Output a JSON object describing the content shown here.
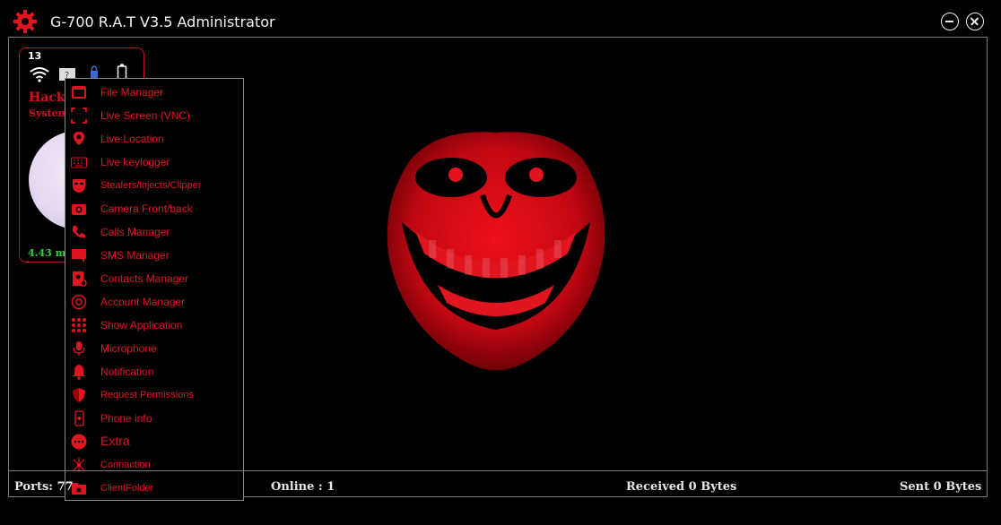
{
  "window": {
    "title": "G-700 R.A.T V3.5 Administrator"
  },
  "client_card": {
    "count": "13",
    "name": "Hacke",
    "system": "System",
    "ping": "4.43 ms"
  },
  "context_menu": {
    "items": [
      {
        "label": "File Manager",
        "icon": "file-manager-icon"
      },
      {
        "label": "Live Screen (VNC)",
        "icon": "screen-capture-icon"
      },
      {
        "label": "Live Location",
        "icon": "location-pin-icon"
      },
      {
        "label": "Live keylogger",
        "icon": "keyboard-icon"
      },
      {
        "label": "Stealers/injects/Clipper",
        "icon": "mask-icon"
      },
      {
        "label": "Camera  Front/back",
        "icon": "camera-icon"
      },
      {
        "label": "Calls Manager",
        "icon": "phone-icon"
      },
      {
        "label": "SMS Manager",
        "icon": "sms-icon"
      },
      {
        "label": "Contacts Manager",
        "icon": "contacts-icon"
      },
      {
        "label": "Account Manager",
        "icon": "at-icon"
      },
      {
        "label": "Show Application",
        "icon": "grid-icon"
      },
      {
        "label": "Microphone",
        "icon": "microphone-icon"
      },
      {
        "label": "Notification",
        "icon": "bell-icon"
      },
      {
        "label": "Request Permissions",
        "icon": "shield-icon"
      },
      {
        "label": "Phone info",
        "icon": "phone-info-icon"
      },
      {
        "label": "Extra",
        "icon": "more-icon"
      },
      {
        "label": "Connaction",
        "icon": "network-icon"
      },
      {
        "label": "ClientFolder",
        "icon": "folder-icon"
      }
    ]
  },
  "status_bar": {
    "ports": "Ports: 77",
    "online": "Online : 1",
    "received": "Received 0 Bytes",
    "sent": "Sent 0 Bytes"
  },
  "colors": {
    "accent": "#e0151f",
    "background": "#000000"
  }
}
